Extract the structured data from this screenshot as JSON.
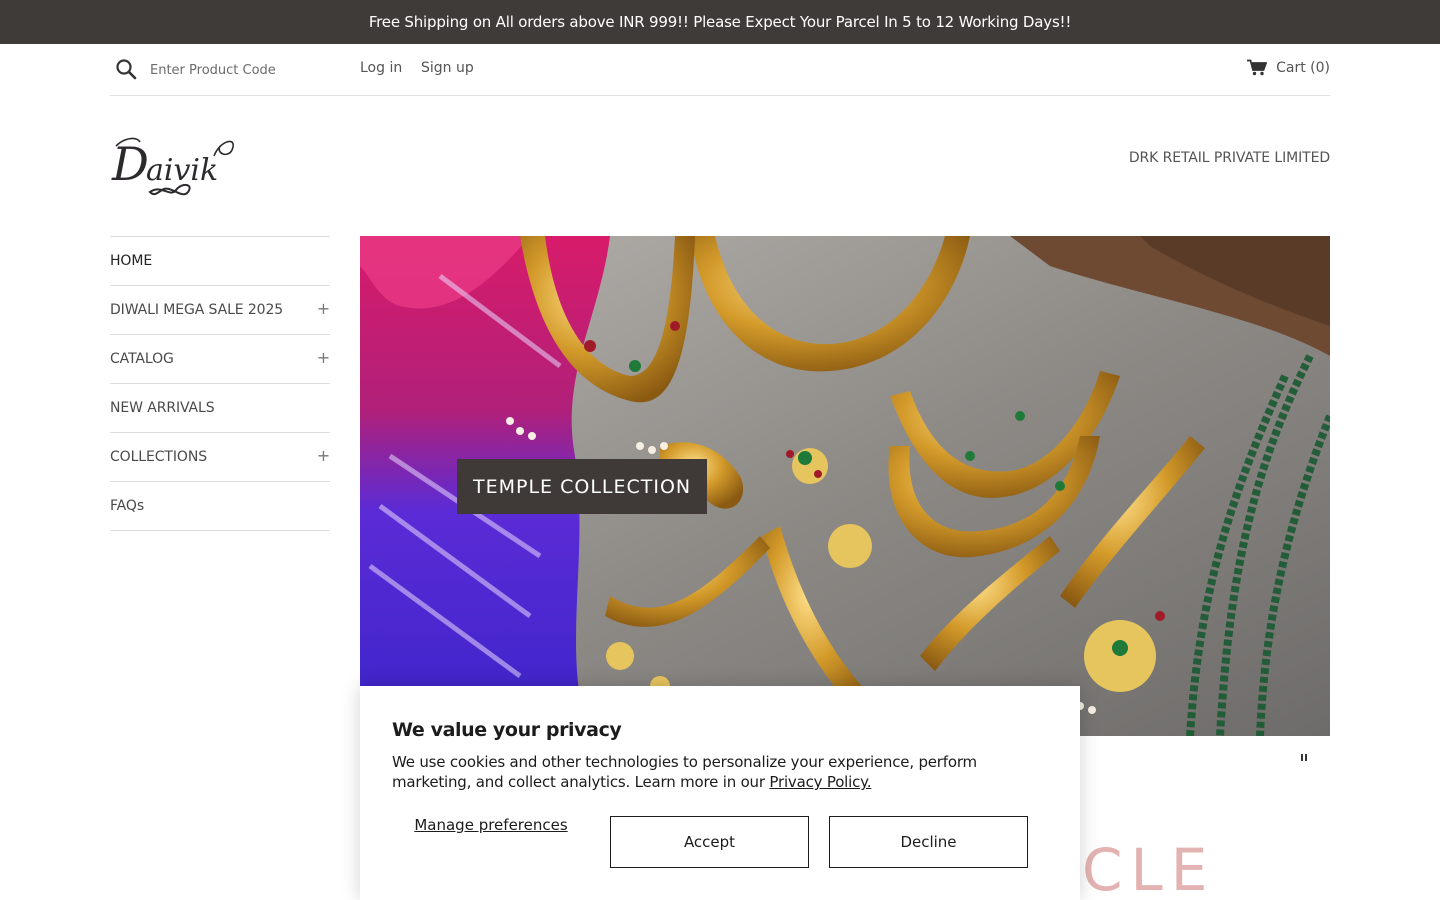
{
  "announcement": "Free Shipping on All orders above INR 999!! Please Expect Your Parcel In 5 to 12 Working Days!!",
  "topbar": {
    "search_placeholder": "Enter Product Code",
    "login": "Log in",
    "signup": "Sign up",
    "cart": "Cart (0)"
  },
  "header": {
    "logo_text": "Daivik",
    "company": "DRK RETAIL PRIVATE LIMITED"
  },
  "sidebar": {
    "items": [
      {
        "label": "HOME",
        "expandable": false
      },
      {
        "label": "DIWALI MEGA SALE 2025",
        "expandable": true
      },
      {
        "label": "CATALOG",
        "expandable": true
      },
      {
        "label": "NEW ARRIVALS",
        "expandable": false
      },
      {
        "label": "COLLECTIONS",
        "expandable": true
      },
      {
        "label": "FAQs",
        "expandable": false
      }
    ],
    "expand_symbol": "+"
  },
  "hero": {
    "caption": "TEMPLE COLLECTION"
  },
  "below_hero_text": "CLE",
  "privacy": {
    "title": "We value your privacy",
    "text": "We use cookies and other technologies to personalize your experience, perform marketing, and collect analytics. Learn more in our ",
    "link": "Privacy Policy.",
    "manage": "Manage preferences",
    "accept": "Accept",
    "decline": "Decline"
  },
  "colors": {
    "announcement_bg": "#3f3b39",
    "caption_bg": "#3f3a38",
    "accent_pink": "#e3b3b1"
  },
  "icons": [
    "search-icon",
    "cart-icon",
    "pause-icon",
    "plus-icon"
  ]
}
